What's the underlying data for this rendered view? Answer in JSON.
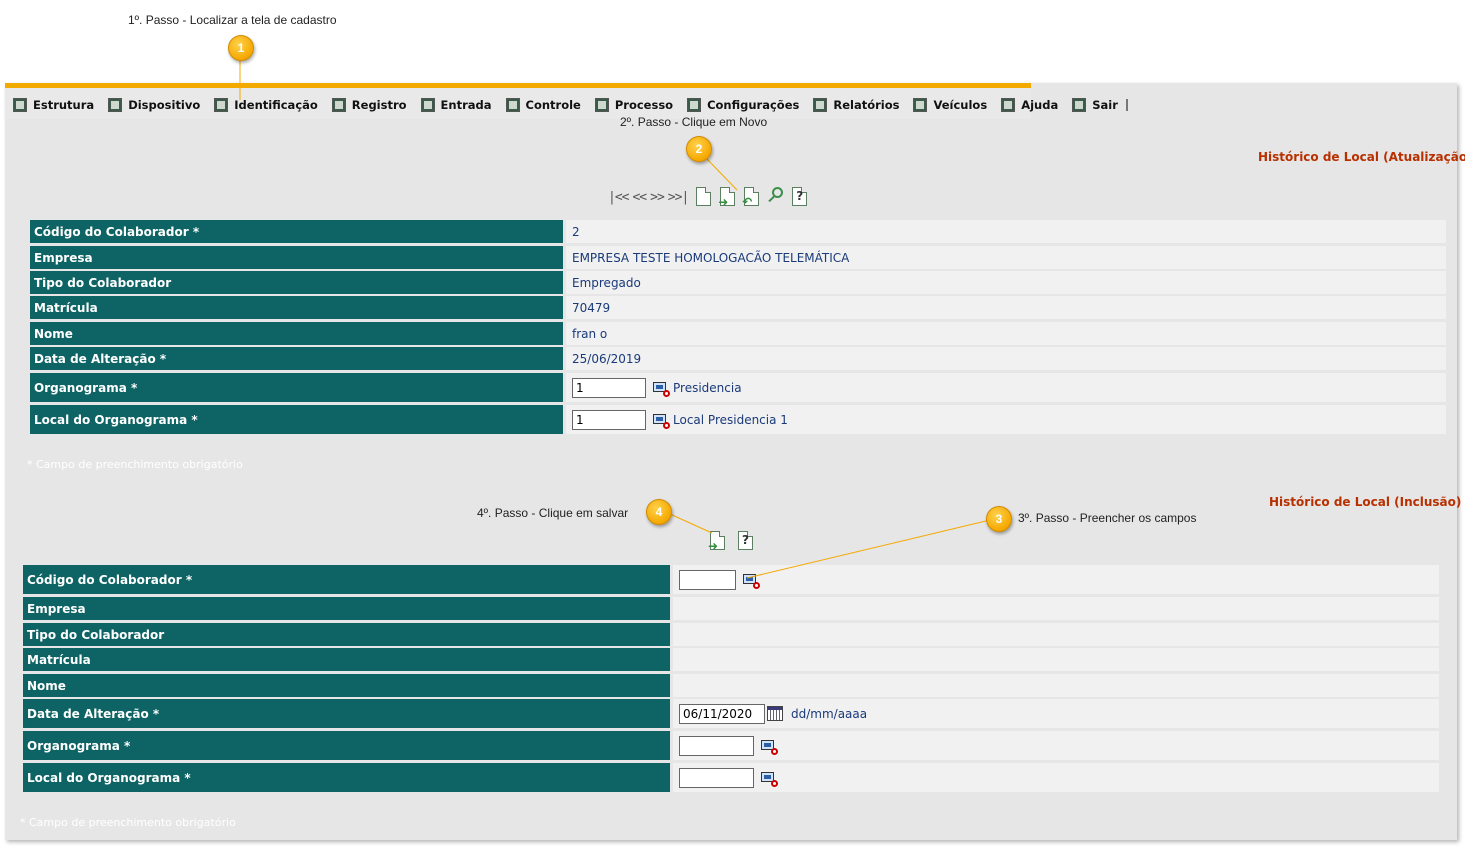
{
  "annotations": {
    "step1": "1º. Passo - Localizar a tela de cadastro",
    "step2": "2º. Passo - Clique em Novo",
    "step3": "3º. Passo - Preencher os campos",
    "step4": "4º. Passo - Clique em salvar",
    "callout1": "1",
    "callout2": "2",
    "callout3": "3",
    "callout4": "4"
  },
  "menu": {
    "items": [
      {
        "label": "Estrutura",
        "icon": "structure-icon"
      },
      {
        "label": "Dispositivo",
        "icon": "device-icon"
      },
      {
        "label": "Identificação",
        "icon": "identification-icon"
      },
      {
        "label": "Registro",
        "icon": "register-icon"
      },
      {
        "label": "Entrada",
        "icon": "entry-icon"
      },
      {
        "label": "Controle",
        "icon": "control-icon"
      },
      {
        "label": "Processo",
        "icon": "process-icon"
      },
      {
        "label": "Configurações",
        "icon": "settings-icon"
      },
      {
        "label": "Relatórios",
        "icon": "reports-icon"
      },
      {
        "label": "Veículos",
        "icon": "vehicles-icon"
      },
      {
        "label": "Ajuda",
        "icon": "help-icon"
      },
      {
        "label": "Sair",
        "icon": "exit-icon"
      }
    ]
  },
  "update_section": {
    "title": "Histórico de Local (Atualização)",
    "nav_first": "|<<",
    "nav_prev": "<<",
    "nav_next": ">>",
    "nav_last": ">>|",
    "fields": {
      "codigo": {
        "label": "Código do Colaborador *",
        "value": "2"
      },
      "empresa": {
        "label": "Empresa",
        "value": "EMPRESA TESTE HOMOLOGACÃO TELEMÁTICA"
      },
      "tipo": {
        "label": "Tipo do Colaborador",
        "value": "Empregado"
      },
      "matricula": {
        "label": "Matrícula",
        "value": "70479"
      },
      "nome": {
        "label": "Nome",
        "value": "fran o"
      },
      "data": {
        "label": "Data de Alteração *",
        "value": "25/06/2019"
      },
      "organograma": {
        "label": "Organograma *",
        "input": "1",
        "desc": "Presidencia"
      },
      "local": {
        "label": "Local do Organograma *",
        "input": "1",
        "desc": "Local Presidencia 1"
      }
    },
    "required_note": "* Campo de preenchimento obrigatório"
  },
  "insert_section": {
    "title": "Histórico de Local (Inclusão)",
    "fields": {
      "codigo": {
        "label": "Código do Colaborador *",
        "input": ""
      },
      "empresa": {
        "label": "Empresa"
      },
      "tipo": {
        "label": "Tipo do Colaborador"
      },
      "matricula": {
        "label": "Matrícula"
      },
      "nome": {
        "label": "Nome"
      },
      "data": {
        "label": "Data de Alteração *",
        "input": "06/11/2020",
        "hint": "dd/mm/aaaa"
      },
      "organograma": {
        "label": "Organograma *",
        "input": ""
      },
      "local": {
        "label": "Local do Organograma *",
        "input": ""
      }
    },
    "required_note": "* Campo de preenchimento obrigatório"
  },
  "colors": {
    "label_bg": "#0e6464",
    "value_bg": "#f1f1f1",
    "section_title": "#b83000",
    "callout": "#f5a800",
    "menu_accent": "#f2a900"
  }
}
